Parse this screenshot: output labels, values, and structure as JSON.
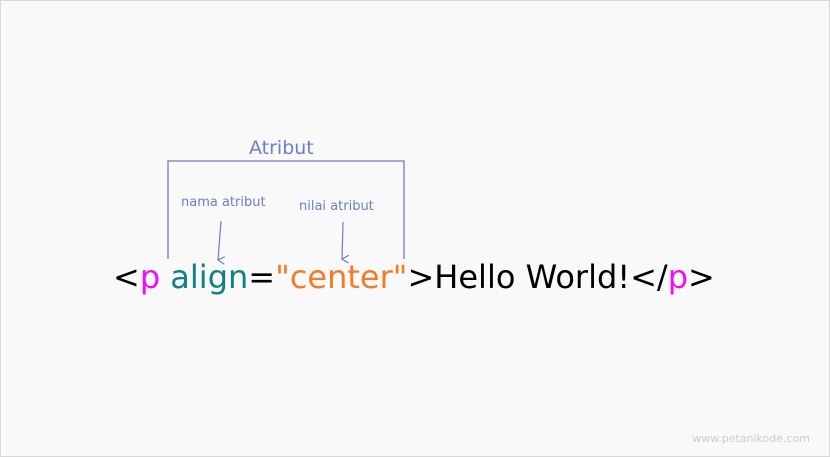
{
  "annotations": {
    "attribute_label": "Atribut",
    "name_label": "nama atribut",
    "value_label": "nilai atribut"
  },
  "code": {
    "open_bracket": "<",
    "tag": "p",
    "space": " ",
    "attr_name": "align",
    "equals": "=",
    "attr_value": "\"center\"",
    "close_bracket": ">",
    "content": "Hello World!",
    "end_open": "</",
    "end_tag": "p",
    "end_close": ">"
  },
  "watermark": "www.petanikode.com",
  "colors": {
    "tag": "#f10cf5",
    "attribute_name": "#0f8087",
    "attribute_value": "#f47c26",
    "annotation": "#6f7cc6",
    "text": "#000000"
  }
}
